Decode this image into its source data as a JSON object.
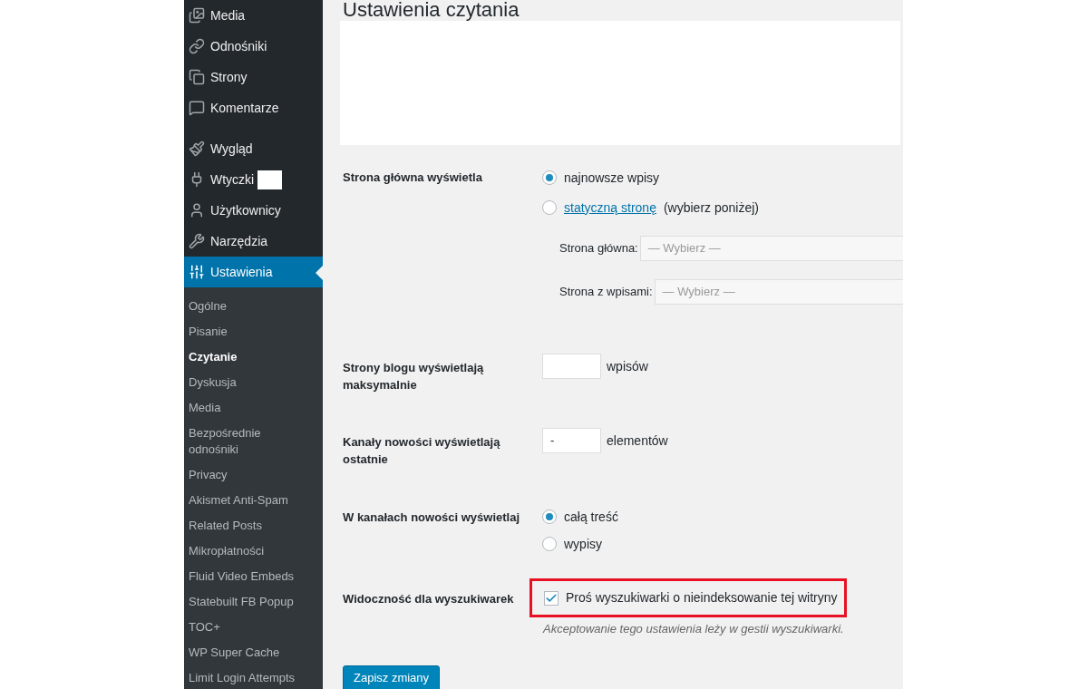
{
  "sidebar": {
    "menu": [
      {
        "label": "Media",
        "selected": false
      },
      {
        "label": "Odnośniki",
        "selected": false
      },
      {
        "label": "Strony",
        "selected": false
      },
      {
        "label": "Komentarze",
        "selected": false
      },
      {
        "label": "Wygląd",
        "selected": false
      },
      {
        "label": "Wtyczki",
        "selected": false
      },
      {
        "label": "Użytkownicy",
        "selected": false
      },
      {
        "label": "Narzędzia",
        "selected": false
      },
      {
        "label": "Ustawienia",
        "selected": true
      }
    ],
    "submenu": [
      {
        "label": "Ogólne",
        "selected": false
      },
      {
        "label": "Pisanie",
        "selected": false
      },
      {
        "label": "Czytanie",
        "selected": true
      },
      {
        "label": "Dyskusja",
        "selected": false
      },
      {
        "label": "Media",
        "selected": false
      },
      {
        "label": "Bezpośrednie odnośniki",
        "selected": false
      },
      {
        "label": "Privacy",
        "selected": false
      },
      {
        "label": "Akismet Anti-Spam",
        "selected": false
      },
      {
        "label": "Related Posts",
        "selected": false
      },
      {
        "label": "Mikropłatności",
        "selected": false
      },
      {
        "label": "Fluid Video Embeds",
        "selected": false
      },
      {
        "label": "Statebuilt FB Popup",
        "selected": false
      },
      {
        "label": "TOC+",
        "selected": false
      },
      {
        "label": "WP Super Cache",
        "selected": false
      },
      {
        "label": "Limit Login Attempts",
        "selected": false
      }
    ]
  },
  "page": {
    "title": "Ustawienia czytania",
    "front_page": {
      "label": "Strona główna wyświetla",
      "options": [
        {
          "text": "najnowsze wpisy",
          "selected": true
        },
        {
          "link": "statyczną stronę",
          "text": "(wybierz poniżej)",
          "selected": false
        }
      ],
      "selects": [
        {
          "label": "Strona główna:",
          "placeholder": "— Wybierz —"
        },
        {
          "label": "Strona z wpisami:",
          "placeholder": "— Wybierz —"
        }
      ]
    },
    "posts_per_page": {
      "label": "Strony blogu wyświetlają maksymalnie",
      "unit": "wpisów"
    },
    "feed_items": {
      "label": "Kanały nowości wyświetlają ostatnie",
      "value": "-",
      "unit": "elementów"
    },
    "feed_content": {
      "label": "W kanałach nowości wyświetlaj",
      "options": [
        {
          "text": "całą treść",
          "selected": true
        },
        {
          "text": "wypisy",
          "selected": false
        }
      ]
    },
    "search_visibility": {
      "label": "Widoczność dla wyszukiwarek",
      "checkbox": "Proś wyszukiwarki o nieindeksowanie tej witryny",
      "checked": true,
      "highlighted": true,
      "description": "Akceptowanie tego ustawienia leży w gestii wyszukiwarki."
    },
    "save_button": "Zapisz zmiany"
  }
}
